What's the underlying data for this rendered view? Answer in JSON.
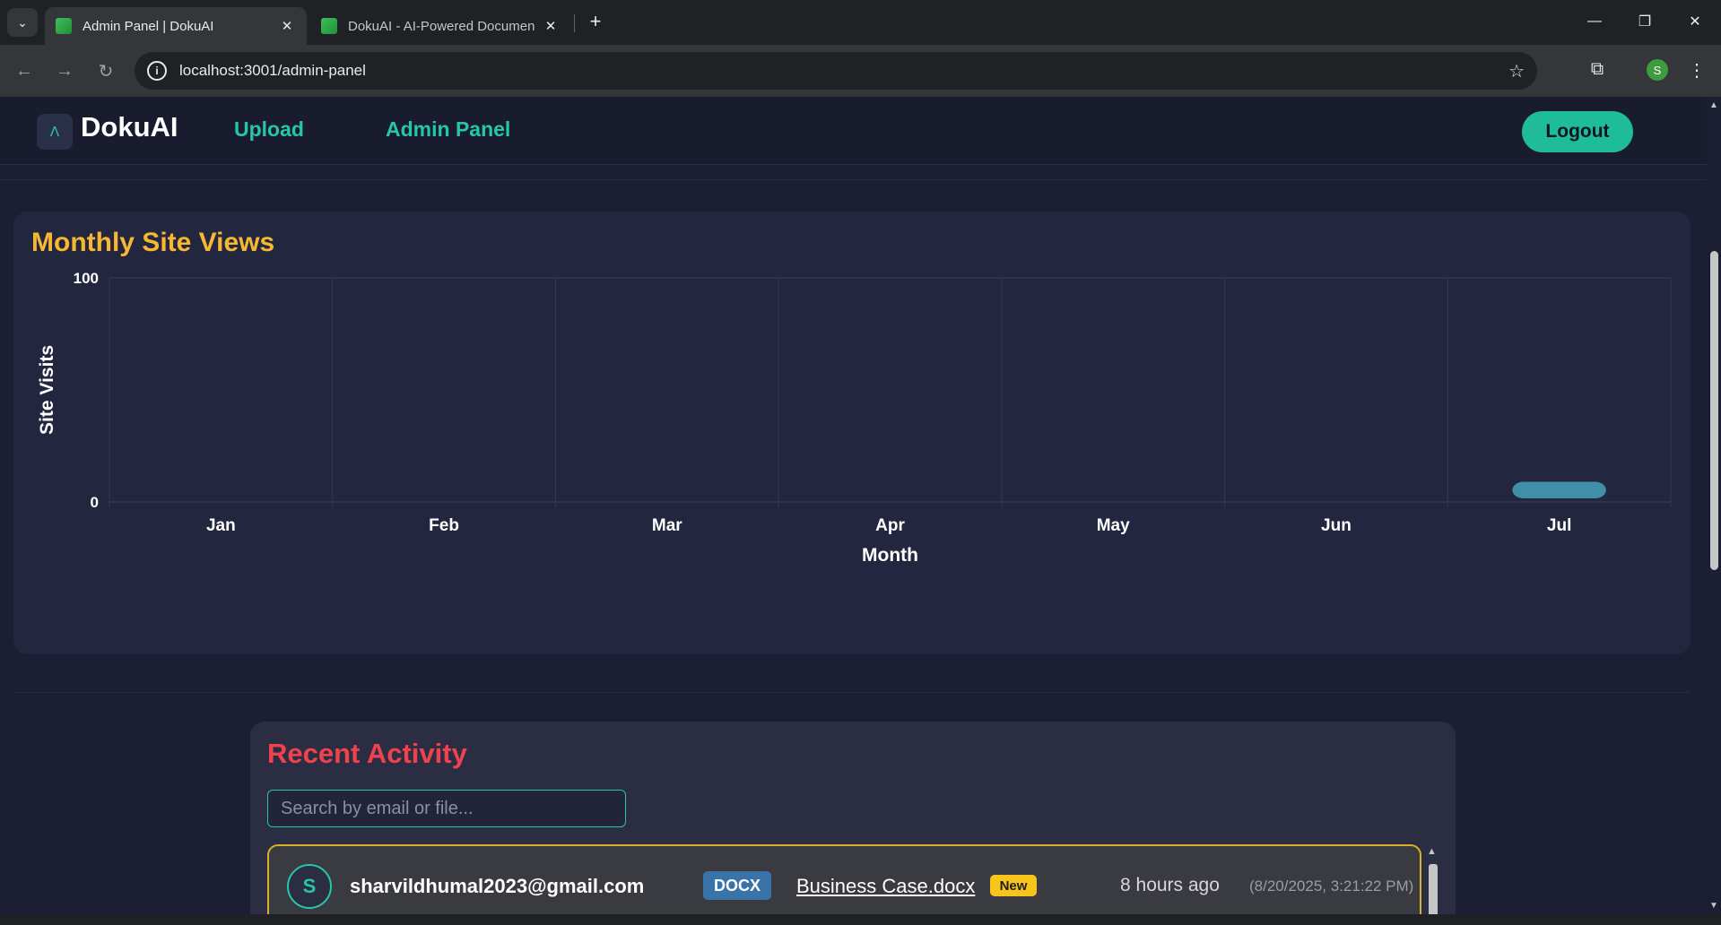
{
  "browser": {
    "tabs": [
      {
        "title": "Admin Panel | DokuAI",
        "active": true
      },
      {
        "title": "DokuAI - AI-Powered Documen",
        "active": false
      }
    ],
    "url": "localhost:3001/admin-panel",
    "profile_initial": "S"
  },
  "navbar": {
    "brand": "DokuAI",
    "links": [
      {
        "label": "Upload"
      },
      {
        "label": "Admin Panel"
      }
    ],
    "logout_label": "Logout"
  },
  "chart_section": {
    "title": "Monthly Site Views"
  },
  "chart_data": {
    "type": "bar",
    "categories": [
      "Jan",
      "Feb",
      "Mar",
      "Apr",
      "May",
      "Jun",
      "Jul"
    ],
    "values": [
      0,
      0,
      0,
      0,
      0,
      0,
      5
    ],
    "title": "Monthly Site Views",
    "xlabel": "Month",
    "ylabel": "Site Visits",
    "ylim": [
      0,
      100
    ],
    "yticks": [
      "0",
      "100"
    ],
    "grid": true,
    "bar_color": "#3f8fa6"
  },
  "activity": {
    "title": "Recent Activity",
    "search_placeholder": "Search by email or file...",
    "rows": [
      {
        "avatar_initial": "S",
        "email": "sharvildhumal2023@gmail.com",
        "file_type": "DOCX",
        "file_name": "Business Case.docx",
        "badge": "New",
        "time_ago": "8 hours ago",
        "time_exact": "(8/20/2025, 3:21:22 PM)"
      }
    ]
  },
  "colors": {
    "accent": "#26c6a8",
    "chart_title": "#f7b731",
    "activity_title": "#f0414f",
    "row_border": "#d9b128"
  }
}
